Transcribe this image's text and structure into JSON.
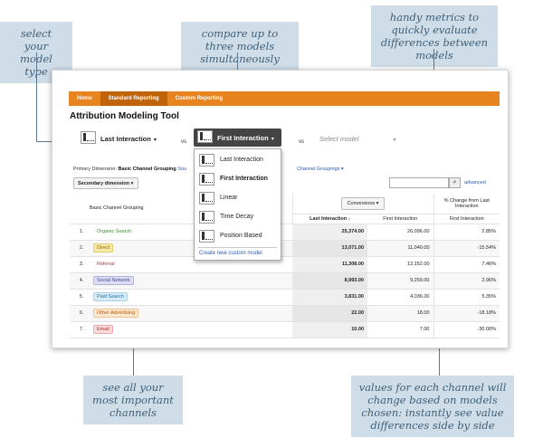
{
  "callouts": {
    "model_type": "select your model type",
    "compare": "compare up to three models simultaneously",
    "metrics": "handy metrics to quickly evaluate differences between models",
    "channels": "see all your most important channels",
    "values": "values for each channel will change based on models chosen: instantly see value differences side by side"
  },
  "tabs": [
    "Home",
    "Standard Reporting",
    "Custom Reporting"
  ],
  "active_tab": 1,
  "page_title": "Attribution Modeling Tool",
  "models": {
    "model1": "Last Interaction",
    "model2": "First Interaction",
    "model3_placeholder": "Select model",
    "vs": "vs"
  },
  "dropdown": {
    "items": [
      "Last Interaction",
      "First Interaction",
      "Linear",
      "Time Decay",
      "Position Based"
    ],
    "icons": [
      "last-interaction-icon",
      "first-interaction-icon",
      "linear-icon",
      "time-decay-icon",
      "position-based-icon"
    ],
    "selected": 1,
    "create": "Create new custom model"
  },
  "primary_dimension": {
    "label": "Primary Dimension:",
    "value": "Basic Channel Grouping",
    "source_link": "Sou",
    "channel_groupings": "Channel Groupings"
  },
  "secondary_dimension": "Secondary dimension",
  "search": {
    "placeholder": "",
    "advanced": "advanced"
  },
  "table": {
    "channel_header": "Basic Channel Grouping",
    "conversions_label": "Conversions",
    "change_header": "% Change from Last Interaction",
    "col_last": "Last Interaction",
    "col_first": "First Interaction",
    "col_change": "First Interaction",
    "rows": [
      {
        "idx": "1.",
        "channel": "Organic Search",
        "last": "25,374.00",
        "first": "26,096.00",
        "change": "2.85%",
        "color": "#3d8c2f",
        "bg": "#ffffff",
        "border": "#ffffff"
      },
      {
        "idx": "2.",
        "channel": "Direct",
        "last": "13,071.00",
        "first": "11,040.00",
        "change": "-15.54%",
        "color": "#8a6d00",
        "bg": "#f7e9a6",
        "border": "#e2cf70"
      },
      {
        "idx": "3.",
        "channel": "Referral",
        "last": "11,308.00",
        "first": "12,152.00",
        "change": "7.46%",
        "color": "#9a3b3b",
        "bg": "#ffffff",
        "border": "#ffffff"
      },
      {
        "idx": "4.",
        "channel": "Social Network",
        "last": "8,993.00",
        "first": "9,259.00",
        "change": "2.96%",
        "color": "#4a4a99",
        "bg": "#dcdcf5",
        "border": "#b3b3e0"
      },
      {
        "idx": "5.",
        "channel": "Paid Search",
        "last": "3,831.00",
        "first": "4,036.00",
        "change": "5.35%",
        "color": "#2a6e9a",
        "bg": "#d6ecf8",
        "border": "#a8d1ea"
      },
      {
        "idx": "6.",
        "channel": "Other Advertising",
        "last": "22.00",
        "first": "18.00",
        "change": "-18.18%",
        "color": "#b05a00",
        "bg": "#fde7cf",
        "border": "#f2c391"
      },
      {
        "idx": "7.",
        "channel": "Email",
        "last": "10.00",
        "first": "7.00",
        "change": "-30.00%",
        "color": "#b03030",
        "bg": "#fadada",
        "border": "#eeaaaa"
      }
    ]
  }
}
